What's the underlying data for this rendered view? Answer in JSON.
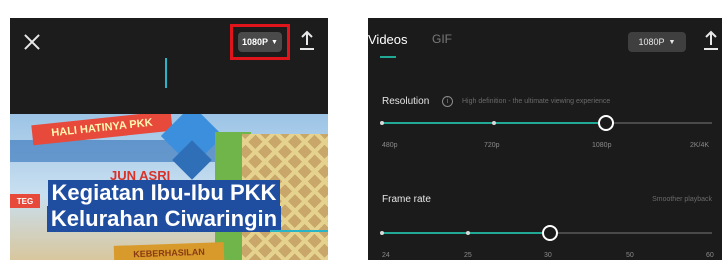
{
  "left_panel": {
    "resolution_button": "1080P",
    "video": {
      "caption_line1": "Kegiatan Ibu-Ibu PKK",
      "caption_line2": "Kelurahan Ciwaringin",
      "banner_text": "HALI HATINYA PKK",
      "sign_text": "JUN ASRI",
      "side_text": "TEG",
      "bottom_sign": "KEBERHASILAN"
    }
  },
  "right_panel": {
    "tabs": [
      {
        "label": "Videos",
        "active": true
      },
      {
        "label": "GIF",
        "active": false
      }
    ],
    "resolution_button": "1080P",
    "resolution": {
      "label": "Resolution",
      "hint": "High definition - the ultimate viewing experience",
      "options": [
        "480p",
        "720p",
        "1080p",
        "2K/4K"
      ],
      "selected": "1080p"
    },
    "frame_rate": {
      "label": "Frame rate",
      "hint": "Smoother playback",
      "options": [
        "24",
        "25",
        "30",
        "50",
        "60"
      ],
      "selected": "30"
    }
  },
  "colors": {
    "accent": "#22a996",
    "highlight": "#e0141b",
    "panel_bg": "#1b1b1b"
  }
}
